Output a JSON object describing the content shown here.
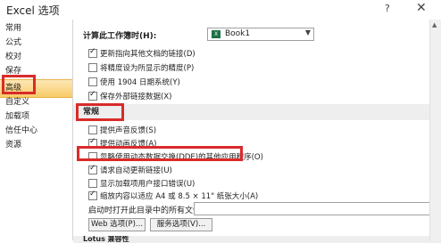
{
  "window": {
    "title": "Excel 选项",
    "help": "?",
    "close": "✕"
  },
  "sidebar": {
    "items": [
      {
        "label": "常用"
      },
      {
        "label": "公式"
      },
      {
        "label": "校对"
      },
      {
        "label": "保存"
      },
      {
        "label": "高级"
      },
      {
        "label": "自定义"
      },
      {
        "label": "加载项"
      },
      {
        "label": "信任中心"
      },
      {
        "label": "资源"
      }
    ],
    "active": "高级"
  },
  "calc": {
    "label": "计算此工作簿时(H):",
    "workbook": "Book1",
    "workbook_icon": "X",
    "options": [
      {
        "label": "更新指向其他文档的链接(D)",
        "checked": true
      },
      {
        "label": "将精度设为所显示的精度(P)",
        "checked": false
      },
      {
        "label": "使用 1904 日期系统(Y)",
        "checked": false
      },
      {
        "label": "保存外部链接数据(X)",
        "checked": true
      }
    ]
  },
  "general": {
    "heading": "常规",
    "options": [
      {
        "label": "提供声音反馈(S)",
        "checked": false,
        "disabled": false
      },
      {
        "label": "提供动画反馈(A)",
        "checked": true,
        "disabled": false
      },
      {
        "label": "忽略使用动态数据交换(DDE)的其他应用程序(O)",
        "checked": false,
        "disabled": false
      },
      {
        "label": "请求自动更新链接(U)",
        "checked": true,
        "disabled": false
      },
      {
        "label": "显示加载项用户接口错误(U)",
        "checked": false,
        "disabled": false
      },
      {
        "label": "缩放内容以适应 A4 或 8.5 × 11\" 纸张大小(A)",
        "checked": true,
        "disabled": false
      }
    ],
    "startup_label": "启动时打开此目录中的所有文件(L):",
    "startup_value": "",
    "web_options_btn": "Web 选项(P)...",
    "service_options_btn": "服务选项(V)..."
  },
  "lotus": {
    "heading": "Lotus 兼容性"
  },
  "colors": {
    "highlight": "#d92b2b",
    "active_start": "#fde7b6",
    "active_end": "#f8cb68"
  }
}
